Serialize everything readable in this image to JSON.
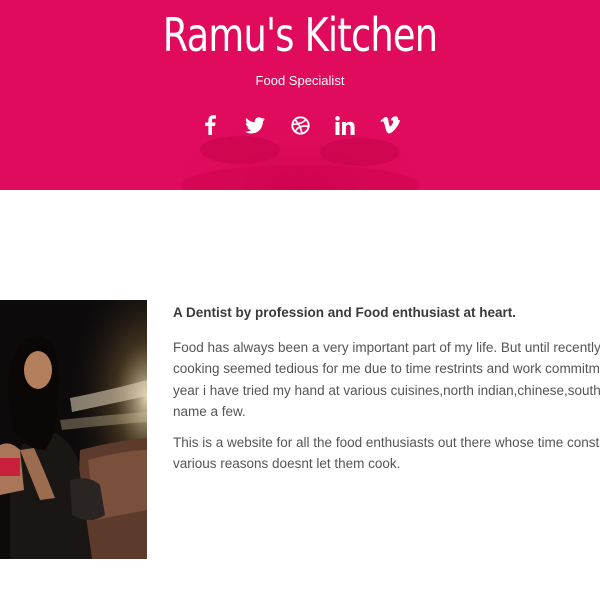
{
  "hero": {
    "title": "Ramu's Kitchen",
    "subtitle": "Food Specialist",
    "accent_color": "#e00b5c",
    "socials": [
      {
        "icon": "facebook-icon"
      },
      {
        "icon": "twitter-icon"
      },
      {
        "icon": "dribbble-icon"
      },
      {
        "icon": "linkedin-icon"
      },
      {
        "icon": "vimeo-icon"
      }
    ]
  },
  "about": {
    "heading": "A Dentist by profession and Food enthusiast at heart.",
    "paragraphs": [
      [
        "Food has always been a very important part of my life. But until recently t",
        "cooking seemed tedious for me due to time restrints and work commitme",
        "year i have tried my hand at various cuisines,north indian,chinese,south in",
        "name a few."
      ],
      [
        "This is a website for all the food enthusiasts out there whose time constra",
        "various reasons doesnt let them cook."
      ]
    ]
  }
}
